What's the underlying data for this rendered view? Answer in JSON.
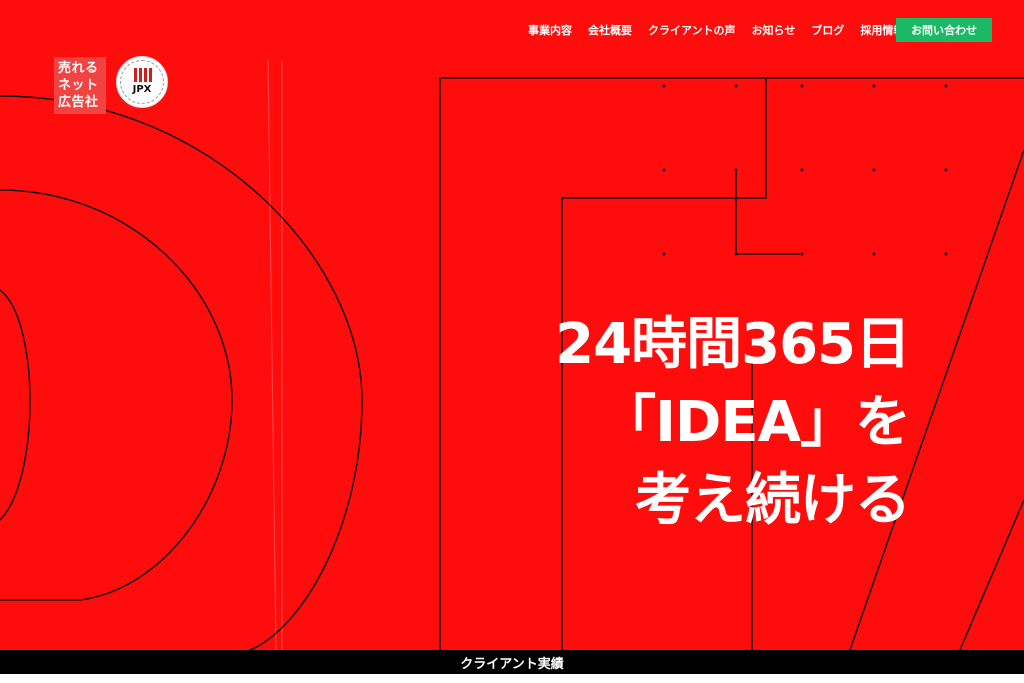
{
  "logo": {
    "lines": [
      "売れる",
      "ネット",
      "広告社"
    ]
  },
  "badge": {
    "text": "JPX"
  },
  "nav": {
    "items": [
      "事業内容",
      "会社概要",
      "クライアントの声",
      "お知らせ",
      "ブログ",
      "採用情報"
    ]
  },
  "contact_label": "お問い合わせ",
  "hero": {
    "lines": [
      "24時間365日",
      "「IDEA」を",
      "考え続ける"
    ]
  },
  "footer_section_title": "クライアント実績",
  "colors": {
    "background": "#ff0c0c",
    "accent_green": "#1bb865",
    "text": "#ffffff"
  }
}
